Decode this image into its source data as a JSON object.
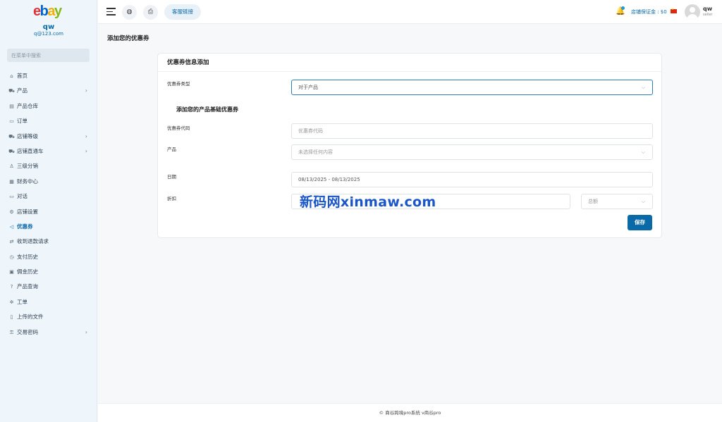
{
  "sidebar": {
    "logo": {
      "e": "e",
      "b": "b",
      "a": "a",
      "y": "y"
    },
    "user_name": "qw",
    "user_email": "q@123.com",
    "search_placeholder": "在菜单中搜索",
    "items": [
      {
        "label": "首页",
        "icon": "home-icon",
        "glyph": "⌂",
        "chevron": false
      },
      {
        "label": "产品",
        "icon": "cart-icon",
        "glyph": "⛟",
        "chevron": true
      },
      {
        "label": "产品仓库",
        "icon": "warehouse-icon",
        "glyph": "▤",
        "chevron": false
      },
      {
        "label": "订单",
        "icon": "order-icon",
        "glyph": "▭",
        "chevron": false
      },
      {
        "label": "店铺等级",
        "icon": "level-icon",
        "glyph": "⛟",
        "chevron": true
      },
      {
        "label": "店铺直通车",
        "icon": "promo-icon",
        "glyph": "⛟",
        "chevron": true
      },
      {
        "label": "三级分销",
        "icon": "user-icon",
        "glyph": "♙",
        "chevron": false
      },
      {
        "label": "财务中心",
        "icon": "finance-icon",
        "glyph": "▦",
        "chevron": false
      },
      {
        "label": "对话",
        "icon": "chat-icon",
        "glyph": "▭",
        "chevron": false
      },
      {
        "label": "店铺设置",
        "icon": "gear-icon",
        "glyph": "⚙",
        "chevron": false
      },
      {
        "label": "优惠券",
        "icon": "megaphone-icon",
        "glyph": "◁",
        "chevron": false,
        "active": true
      },
      {
        "label": "收到退款请求",
        "icon": "refund-icon",
        "glyph": "⇄",
        "chevron": false
      },
      {
        "label": "支付历史",
        "icon": "history-icon",
        "glyph": "◷",
        "chevron": false
      },
      {
        "label": "佣金历史",
        "icon": "commission-icon",
        "glyph": "▣",
        "chevron": false
      },
      {
        "label": "产品查询",
        "icon": "query-icon",
        "glyph": "?",
        "chevron": false
      },
      {
        "label": "工单",
        "icon": "ticket-icon",
        "glyph": "✲",
        "chevron": false
      },
      {
        "label": "上传的文件",
        "icon": "file-icon",
        "glyph": "▯",
        "chevron": false
      },
      {
        "label": "交易密码",
        "icon": "key-icon",
        "glyph": "⚿",
        "chevron": true
      }
    ]
  },
  "header": {
    "hamburger_icon": "hamburger-icon",
    "globe_icon": "globe-icon",
    "globe_glyph": "◍",
    "print_icon": "printer-icon",
    "print_glyph": "⎙",
    "cs_label": "客服链接",
    "bell_glyph": "🔔",
    "deposit_label": "店铺保证金 : $0",
    "user_name": "qw",
    "user_role": "seller"
  },
  "page": {
    "title": "添加您的优惠券",
    "card_title": "优惠券信息添加",
    "coupon_type_label": "优惠券类型",
    "coupon_type_value": "对于产品",
    "section_title": "添加您的产品基础优惠券",
    "code_label": "优惠券代码",
    "code_placeholder": "优惠券代码",
    "product_label": "产品",
    "product_placeholder": "未选择任何内容",
    "date_label": "日期",
    "date_value": "08/13/2025 - 08/13/2025",
    "discount_label": "折扣",
    "discount_type_value": "总额",
    "dropdown_glyph": "⌵",
    "save_label": "保存",
    "watermark": "新码网xinmaw.com"
  },
  "footer": {
    "text": "© 商谷跨境pro系统 v商谷pro"
  },
  "colors": {
    "accent": "#0a6aa8",
    "sidebar_bg": "#eef5fb"
  }
}
